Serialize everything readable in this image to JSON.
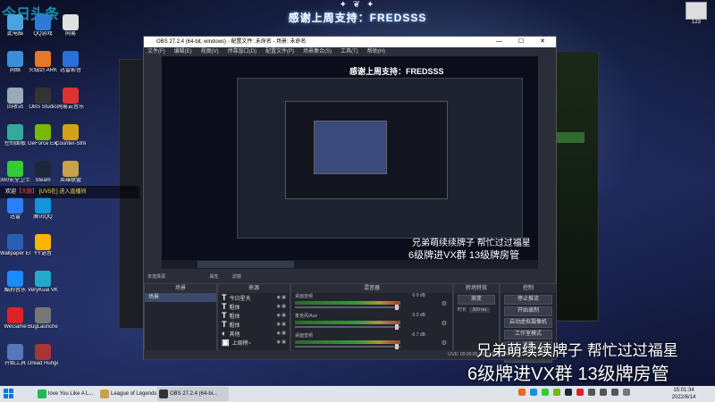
{
  "banner": {
    "crown": "✦ ❦ ✦",
    "title": "感谢上周支持：FREDSSS"
  },
  "logo": "今日头条",
  "topright_icon": {
    "label": "123"
  },
  "desktop_icons": [
    {
      "label": "此电脑",
      "color": "#4aa3df"
    },
    {
      "label": "QQ游戏",
      "color": "#2e7bd6"
    },
    {
      "label": "网易",
      "color": "#e0e0e0"
    },
    {
      "label": "网络",
      "color": "#3b8fd9"
    },
    {
      "label": "火绒剑 ARK",
      "color": "#e8762b"
    },
    {
      "label": "迅雷影音",
      "color": "#2a6fdb"
    },
    {
      "label": "回收站",
      "color": "#9ab"
    },
    {
      "label": "OBS Studio",
      "color": "#333"
    },
    {
      "label": "网易云音乐",
      "color": "#d33"
    },
    {
      "label": "控制面板",
      "color": "#3a9"
    },
    {
      "label": "GeForce Experience",
      "color": "#76b900"
    },
    {
      "label": "Counter-Strike",
      "color": "#d4a017"
    },
    {
      "label": "360安全卫士",
      "color": "#3c3"
    },
    {
      "label": "Steam",
      "color": "#1b2838"
    },
    {
      "label": "英雄联盟",
      "color": "#c9a14a"
    },
    {
      "label": "迅雷",
      "color": "#2a80ff"
    },
    {
      "label": "腾讯QQ",
      "color": "#1296db"
    },
    {
      "label": "Wallpaper Engine",
      "color": "#2a5fb0"
    },
    {
      "label": "YY语音",
      "color": "#ffb400"
    },
    {
      "label": "酷狗音乐",
      "color": "#1a8cff"
    },
    {
      "label": "VeryKuai VK",
      "color": "#2ac"
    },
    {
      "label": "WeGame",
      "color": "#d22"
    },
    {
      "label": "BugLauncher",
      "color": "#777"
    },
    {
      "label": "开始工具",
      "color": "#57b"
    },
    {
      "label": "Dread Hunger",
      "color": "#a33"
    }
  ],
  "chat": {
    "prefix": "欢迎",
    "user": "[大腿]",
    "verb": "【大腿】",
    "rest": "[UV5在] 进入直播间"
  },
  "obs": {
    "title": "OBS 27.2.4 (64-bit, windows) - 配置文件: 未命名 - 场景: 未命名",
    "window_controls": "— ☐ ✕",
    "menu": [
      "文件(F)",
      "编辑(E)",
      "视图(V)",
      "停靠窗口(D)",
      "配置文件(P)",
      "场景集合(S)",
      "工具(T)",
      "帮助(H)"
    ],
    "preview": {
      "title": "感谢上周支持：FREDSSS",
      "line1": "兄弟萌续续牌子  帮忙过过福星",
      "line2": "6级牌进VX群  13级牌房管"
    },
    "toolbar": {
      "no_source": "未选择源",
      "props": "属性",
      "filters": "滤镜"
    },
    "docks": {
      "scenes": {
        "header": "场景",
        "items": [
          "场景"
        ]
      },
      "sources": {
        "header": "来源",
        "items": [
          {
            "type": "T",
            "label": "今日星天"
          },
          {
            "type": "T",
            "label": "粗体"
          },
          {
            "type": "T",
            "label": "粗体"
          },
          {
            "type": "T",
            "label": "粗体"
          },
          {
            "type": "◐",
            "label": "其他"
          },
          {
            "type": "▣",
            "label": "上周榜~"
          }
        ]
      },
      "mixer": {
        "header": "混音器",
        "rows": [
          {
            "label": "桌面音频",
            "db": "0.0 dB"
          },
          {
            "label": "麦克风/Aux",
            "db": "0.0 dB"
          },
          {
            "label": "桌面音频",
            "db": "-6.7 dB"
          }
        ]
      },
      "transitions": {
        "header": "转场特效",
        "type": "渐变",
        "duration_label": "时长",
        "duration": "300 ms"
      },
      "controls": {
        "header": "控制",
        "buttons": [
          "停止推流",
          "开始录制",
          "启动虚拟摄像机",
          "工作室模式",
          "设置",
          "退出"
        ]
      }
    },
    "dock_footer": "+ − ∧ ∨",
    "status": "LIVE: 00:00:00   REC: 00:00:00   CPU: 1.6%, 60.00 fps"
  },
  "overlay": {
    "line1": "兄弟萌续续牌子  帮忙过过福星",
    "line2": "6级牌进VX群  13级牌房管"
  },
  "taskbar": {
    "items": [
      {
        "label": "love You Like A L...",
        "color": "#1db954"
      },
      {
        "label": "League of Legends",
        "color": "#c9a14a"
      },
      {
        "label": "OBS 27.2.4 (64-bi...",
        "color": "#333"
      }
    ],
    "time": "15:01:34",
    "date": "2022/6/14"
  }
}
